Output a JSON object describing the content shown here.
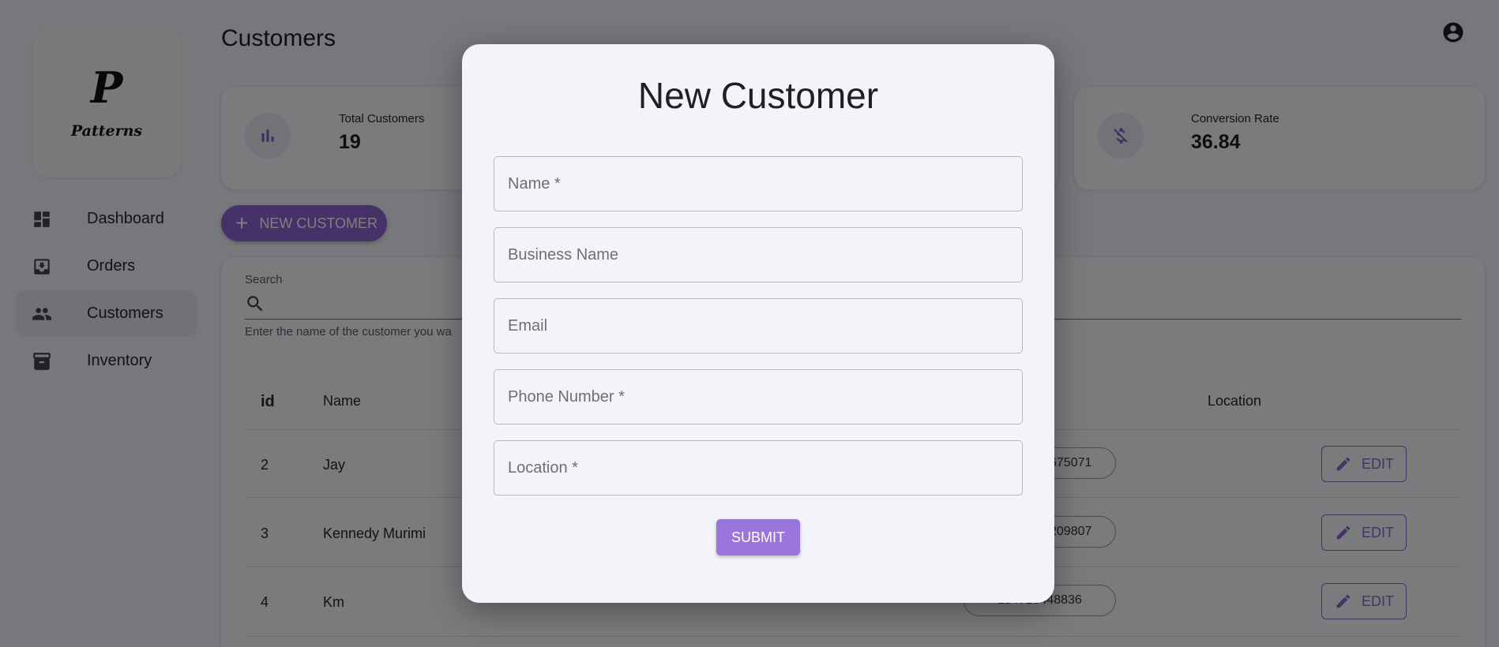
{
  "brand": {
    "logo_letter": "P",
    "logo_word": "Patterns"
  },
  "sidebar": {
    "items": [
      {
        "label": "Dashboard",
        "icon": "dashboard-icon",
        "active": false
      },
      {
        "label": "Orders",
        "icon": "inbox-download-icon",
        "active": false
      },
      {
        "label": "Customers",
        "icon": "people-icon",
        "active": true
      },
      {
        "label": "Inventory",
        "icon": "archive-icon",
        "active": false
      }
    ]
  },
  "header": {
    "title": "Customers",
    "account_icon": "account-circle-icon"
  },
  "stats": [
    {
      "label": "Total Customers",
      "value": "19",
      "icon": "bar-chart-icon"
    },
    {
      "label": "Conversion Rate",
      "value": "36.84",
      "icon": "money-off-icon"
    }
  ],
  "actions": {
    "new_customer_label": "NEW CUSTOMER"
  },
  "search": {
    "label": "Search",
    "helper": "Enter the name of the customer you wa"
  },
  "table": {
    "columns": {
      "id": "id",
      "name": "Name",
      "location": "Location"
    },
    "rows": [
      {
        "id": "2",
        "name": "Jay",
        "phone": "675071",
        "action": "EDIT"
      },
      {
        "id": "3",
        "name": "Kennedy Murimi",
        "phone": "209807",
        "action": "EDIT"
      },
      {
        "id": "4",
        "name": "Km",
        "phone": "254718448836",
        "action": "EDIT"
      }
    ]
  },
  "modal": {
    "title": "New Customer",
    "fields": {
      "name": "Name *",
      "business_name": "Business Name",
      "email": "Email",
      "phone": "Phone Number *",
      "location": "Location *"
    },
    "submit_label": "SUBMIT"
  },
  "colors": {
    "accent": "#8d62d2",
    "submit": "#9a76dc",
    "backdrop": "rgba(0,0,0,0.5)"
  }
}
